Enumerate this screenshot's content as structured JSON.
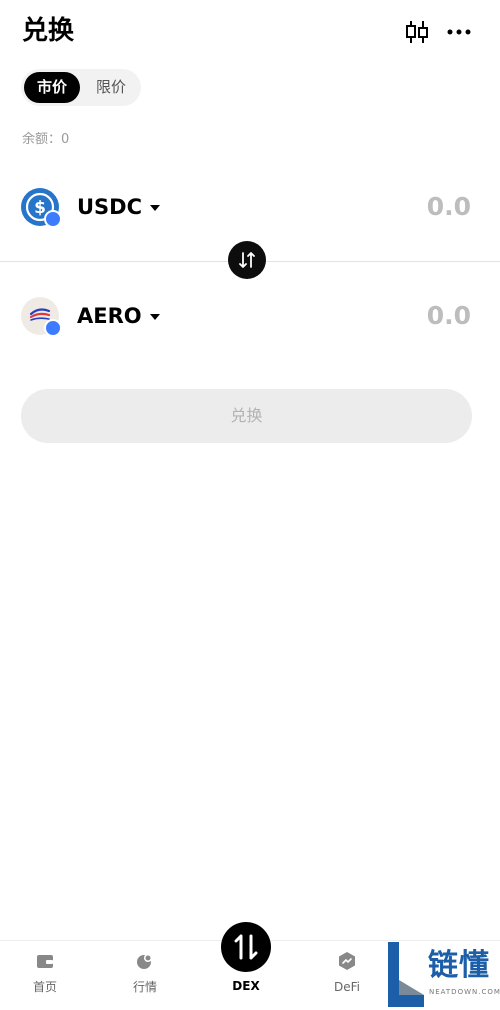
{
  "header": {
    "title": "兑换",
    "chart_icon": "candlestick-chart-icon",
    "more_icon": "more-dots-icon"
  },
  "order_tabs": {
    "market": "市价",
    "limit": "限价",
    "active": "market"
  },
  "balance_text": "余额：0",
  "from_token": {
    "symbol": "USDC",
    "amount": "0.0",
    "icon": "usdc-logo-icon"
  },
  "to_token": {
    "symbol": "AERO",
    "amount": "0.0",
    "icon": "aero-logo-icon"
  },
  "swap_button": {
    "label": "兑换"
  },
  "bottom_nav": {
    "items": [
      {
        "label": "首页",
        "icon": "wallet-icon"
      },
      {
        "label": "行情",
        "icon": "market-icon"
      },
      {
        "label": "DEX",
        "icon": "swap-arrows-icon",
        "active": true
      },
      {
        "label": "DeFi",
        "icon": "defi-icon"
      }
    ]
  },
  "watermark": {
    "text": "链懂",
    "sub": "NEATDOWN.COM"
  },
  "colors": {
    "accent": "#000000",
    "badge": "#3d7bff",
    "usdc": "#2775ca",
    "disabled_text": "#b3b3b3"
  }
}
